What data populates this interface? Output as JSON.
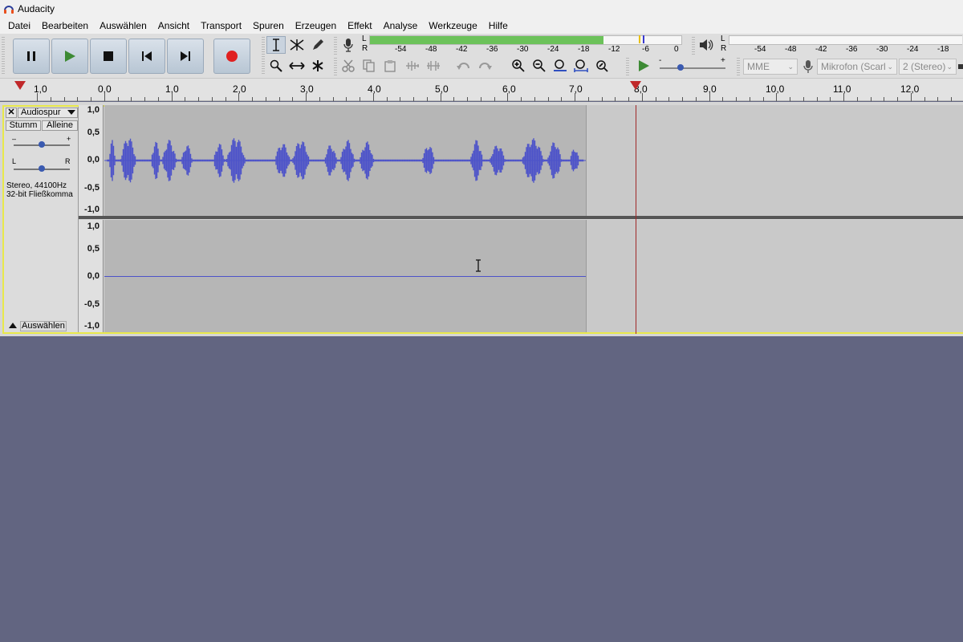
{
  "window": {
    "title": "Audacity"
  },
  "menu": [
    "Datei",
    "Bearbeiten",
    "Auswählen",
    "Ansicht",
    "Transport",
    "Spuren",
    "Erzeugen",
    "Effekt",
    "Analyse",
    "Werkzeuge",
    "Hilfe"
  ],
  "meters": {
    "record": {
      "channels": [
        "L",
        "R"
      ],
      "scale": [
        "-54",
        "-48",
        "-42",
        "-36",
        "-30",
        "-24",
        "-18",
        "-12",
        "-6",
        "0"
      ]
    },
    "playback": {
      "channels": [
        "L",
        "R"
      ],
      "scale": [
        "-54",
        "-48",
        "-42",
        "-36",
        "-30",
        "-24",
        "-18"
      ]
    }
  },
  "devices": {
    "host": "MME",
    "input": "Mikrofon (Scarl",
    "channels": "2 (Stereo)"
  },
  "ruler": {
    "labels": [
      "1,0",
      "0,0",
      "1,0",
      "2,0",
      "3,0",
      "4,0",
      "5,0",
      "6,0",
      "7,0",
      "8,0",
      "9,0",
      "10,0",
      "11,0",
      "12,0"
    ]
  },
  "track": {
    "name": "Audiospur",
    "mute": "Stumm",
    "solo": "Alleine",
    "gain_minus": "–",
    "gain_plus": "+",
    "pan_left": "L",
    "pan_right": "R",
    "info_line1": "Stereo, 44100Hz",
    "info_line2": "32-bit Fließkomma",
    "select": "Auswählen",
    "scale": [
      "1,0",
      "0,5",
      "0,0",
      "-0,5",
      "-1,0"
    ]
  },
  "colors": {
    "waveform": "#4d53c9",
    "selection_border": "#e8e84a",
    "background": "#626581",
    "cursor": "#a02828"
  }
}
